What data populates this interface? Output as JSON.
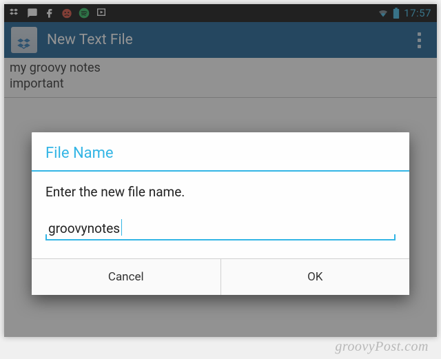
{
  "status": {
    "clock": "17:57"
  },
  "actionbar": {
    "title": "New Text File"
  },
  "editor": {
    "content": "my groovy notes\nimportant"
  },
  "dialog": {
    "title": "File Name",
    "message": "Enter the new file name.",
    "input_value": "groovynotes",
    "cancel_label": "Cancel",
    "ok_label": "OK"
  },
  "watermark": "groovyPost.com"
}
